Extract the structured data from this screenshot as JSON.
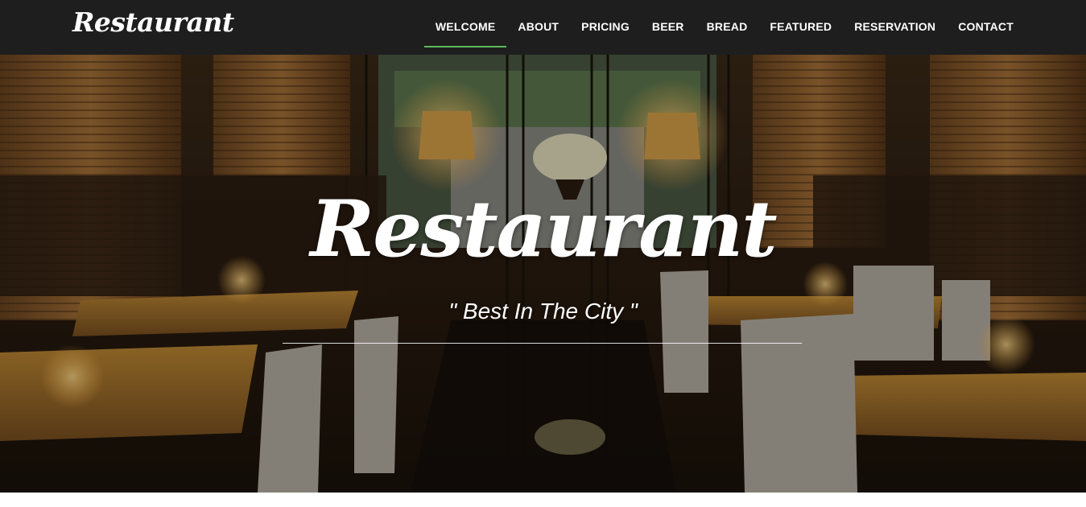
{
  "header": {
    "brand": "Restaurant",
    "nav": [
      {
        "label": "WELCOME",
        "active": true
      },
      {
        "label": "ABOUT"
      },
      {
        "label": "PRICING"
      },
      {
        "label": "BEER"
      },
      {
        "label": "BREAD"
      },
      {
        "label": "FEATURED"
      },
      {
        "label": "RESERVATION"
      },
      {
        "label": "CONTACT"
      }
    ]
  },
  "hero": {
    "title": "Restaurant",
    "subtitle": "\" Best In The City \""
  },
  "colors": {
    "header_bg": "#1e1e1e",
    "active_underline": "#5fb85a",
    "text": "#ffffff"
  }
}
